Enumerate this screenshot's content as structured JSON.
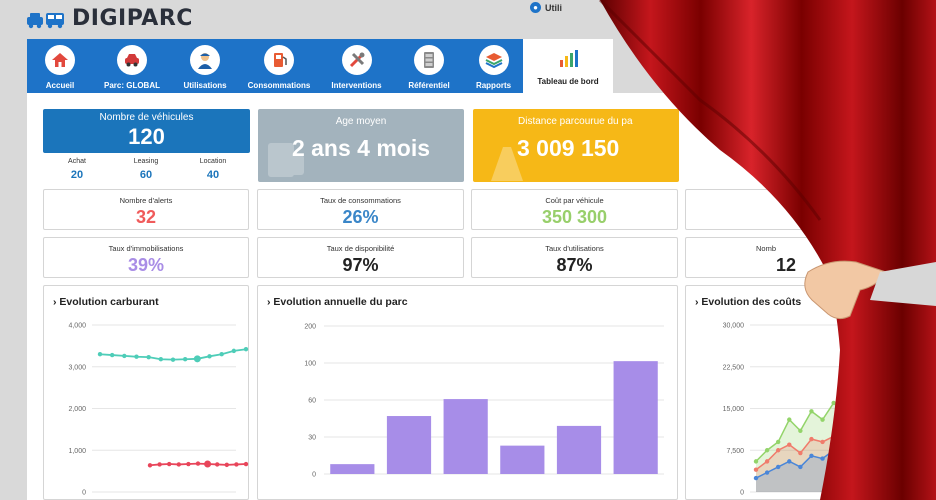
{
  "app": {
    "logo_text": "DIGIPARC",
    "user_label": "Utili"
  },
  "nav": {
    "items": [
      {
        "label": "Accueil",
        "icon": "home-icon"
      },
      {
        "label": "Parc: GLOBAL",
        "icon": "car-icon"
      },
      {
        "label": "Utilisations",
        "icon": "driver-icon"
      },
      {
        "label": "Consommations",
        "icon": "fuel-pump-icon"
      },
      {
        "label": "Interventions",
        "icon": "tools-icon"
      },
      {
        "label": "Référentiel",
        "icon": "cabinet-icon"
      },
      {
        "label": "Rapports",
        "icon": "layers-icon"
      }
    ],
    "active": {
      "label": "Tableau de bord",
      "icon": "bar-chart-icon"
    }
  },
  "kpis": {
    "vehicles": {
      "title": "Nombre de véhicules",
      "value": "120",
      "color": "#1b75bb"
    },
    "age": {
      "title": "Age moyen",
      "value": "2 ans 4 mois",
      "color": "#a3b3bd"
    },
    "distance": {
      "title": "Distance parcourue du pa",
      "value": "3 009 150",
      "color": "#f6b817"
    }
  },
  "vehicle_breakdown": [
    {
      "label": "Achat",
      "value": "20"
    },
    {
      "label": "Leasing",
      "value": "60"
    },
    {
      "label": "Location",
      "value": "40"
    }
  ],
  "stats_row1": [
    {
      "label": "Nombre d'alerts",
      "value": "32",
      "color": "#f05b5b"
    },
    {
      "label": "Taux de consommations",
      "value": "26%",
      "color": "#3a86c8"
    },
    {
      "label": "Coût par véhicule",
      "value": "350 300",
      "color": "#98cf6b"
    }
  ],
  "stats_row2": [
    {
      "label": "Taux d'immobilisations",
      "value": "39%",
      "color": "#a98de6"
    },
    {
      "label": "Taux de disponibilité",
      "value": "97%",
      "color": "#222222"
    },
    {
      "label": "Taux d'utilisations",
      "value": "87%",
      "color": "#222222"
    },
    {
      "label": "Nomb",
      "value": "12",
      "color": "#222222"
    }
  ],
  "panels": {
    "fuel": "› Evolution carburant",
    "fleet": "› Evolution annuelle du parc",
    "costs": "› Evolution des coûts"
  },
  "chart_data": [
    {
      "type": "line",
      "title": "Evolution carburant",
      "ylim": [
        0,
        4000
      ],
      "yticks": [
        "4,000",
        "3,000",
        "2,000",
        "1,000",
        "0"
      ],
      "series": [
        {
          "color": "#4ecdb8",
          "values": [
            3300,
            3280,
            3260,
            3240,
            3230,
            3180,
            3170,
            3180,
            3190,
            3250,
            3300,
            3380,
            3420
          ]
        },
        {
          "color": "#e8455a",
          "values": [
            640,
            660,
            670,
            660,
            670,
            680,
            670,
            660,
            650,
            660,
            670
          ]
        }
      ]
    },
    {
      "type": "bar",
      "title": "Evolution annuelle du parc",
      "ylim": [
        0,
        200
      ],
      "yticks": [
        "200",
        "100",
        "60",
        "30",
        "0"
      ],
      "values": [
        8,
        47,
        61,
        23,
        39,
        105
      ],
      "color": "#a78de8"
    },
    {
      "type": "area",
      "title": "Evolution des coûts",
      "ylim": [
        0,
        30000
      ],
      "yticks": [
        "30,000",
        "22,500",
        "15,000",
        "7,500",
        "0"
      ],
      "series": [
        {
          "color": "#93d46a",
          "values": [
            5500,
            7500,
            9000,
            13000,
            11000,
            14500,
            13000,
            16000,
            14000,
            17000,
            16500,
            18000
          ]
        },
        {
          "color": "#f07b6b",
          "values": [
            4000,
            5500,
            7500,
            8500,
            7000,
            9500,
            9000,
            10000,
            9500,
            11000,
            10500,
            13000
          ]
        },
        {
          "color": "#4a86d8",
          "values": [
            2500,
            3500,
            4500,
            5500,
            4500,
            6500,
            6000,
            7500,
            6500,
            8000,
            7500,
            9000
          ]
        }
      ]
    }
  ]
}
